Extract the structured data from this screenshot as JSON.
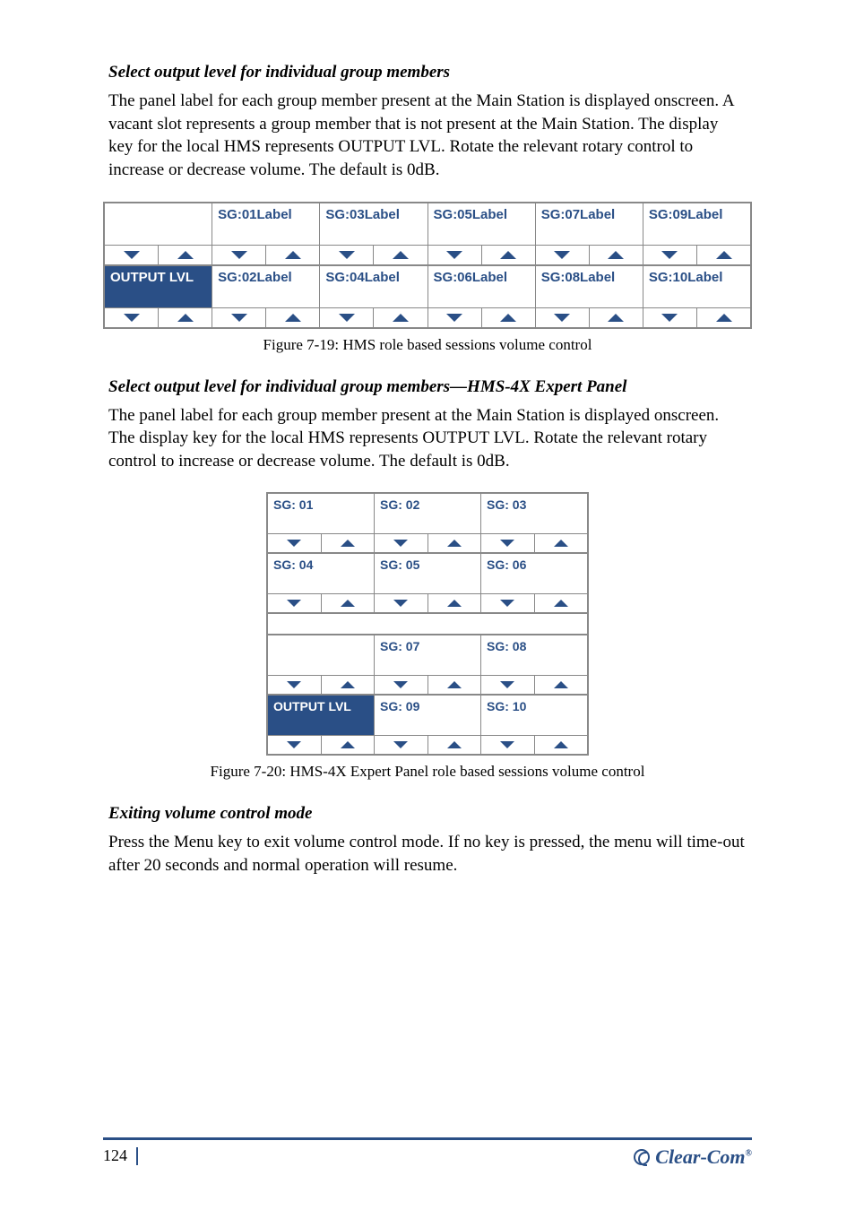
{
  "section1": {
    "title": "Select output level for individual group members",
    "body": "The panel label for each group member present at the Main Station is displayed onscreen. A vacant slot represents a group member that is not present at the Main Station. The display key for the local HMS represents OUTPUT LVL. Rotate the relevant rotary control to increase or decrease volume. The default is 0dB."
  },
  "table1": {
    "rows": [
      [
        "",
        "SG:01Label",
        "SG:03Label",
        "SG:05Label",
        "SG:07Label",
        "SG:09Label"
      ],
      [
        "OUTPUT LVL",
        "SG:02Label",
        "SG:04Label",
        "SG:06Label",
        "SG:08Label",
        "SG:10Label"
      ]
    ],
    "invert": [
      [
        false,
        false,
        false,
        false,
        false,
        false
      ],
      [
        true,
        false,
        false,
        false,
        false,
        false
      ]
    ],
    "caption": "Figure 7-19: HMS role based sessions volume control"
  },
  "section2": {
    "title": "Select output level for individual group members—HMS-4X Expert Panel",
    "body": "The panel label for each group member present at the Main Station is displayed onscreen. The display key for the local HMS represents OUTPUT LVL. Rotate the relevant rotary control to increase or decrease volume. The default is 0dB."
  },
  "table2": {
    "rows": [
      [
        "SG: 01",
        "SG: 02",
        "SG: 03"
      ],
      [
        "SG: 04",
        "SG: 05",
        "SG: 06"
      ],
      [
        "",
        "SG: 07",
        "SG: 08"
      ],
      [
        "OUTPUT LVL",
        "SG: 09",
        "SG: 10"
      ]
    ],
    "invert": [
      [
        false,
        false,
        false
      ],
      [
        false,
        false,
        false
      ],
      [
        false,
        false,
        false
      ],
      [
        true,
        false,
        false
      ]
    ],
    "caption": "Figure 7-20: HMS-4X Expert Panel role based sessions volume control"
  },
  "section3": {
    "title": "Exiting volume control mode",
    "body": "Press the Menu key to exit volume control mode. If no key is pressed, the menu will time-out after 20 seconds and normal operation will resume."
  },
  "footer": {
    "page": "124",
    "brand": "Clear-Com"
  }
}
